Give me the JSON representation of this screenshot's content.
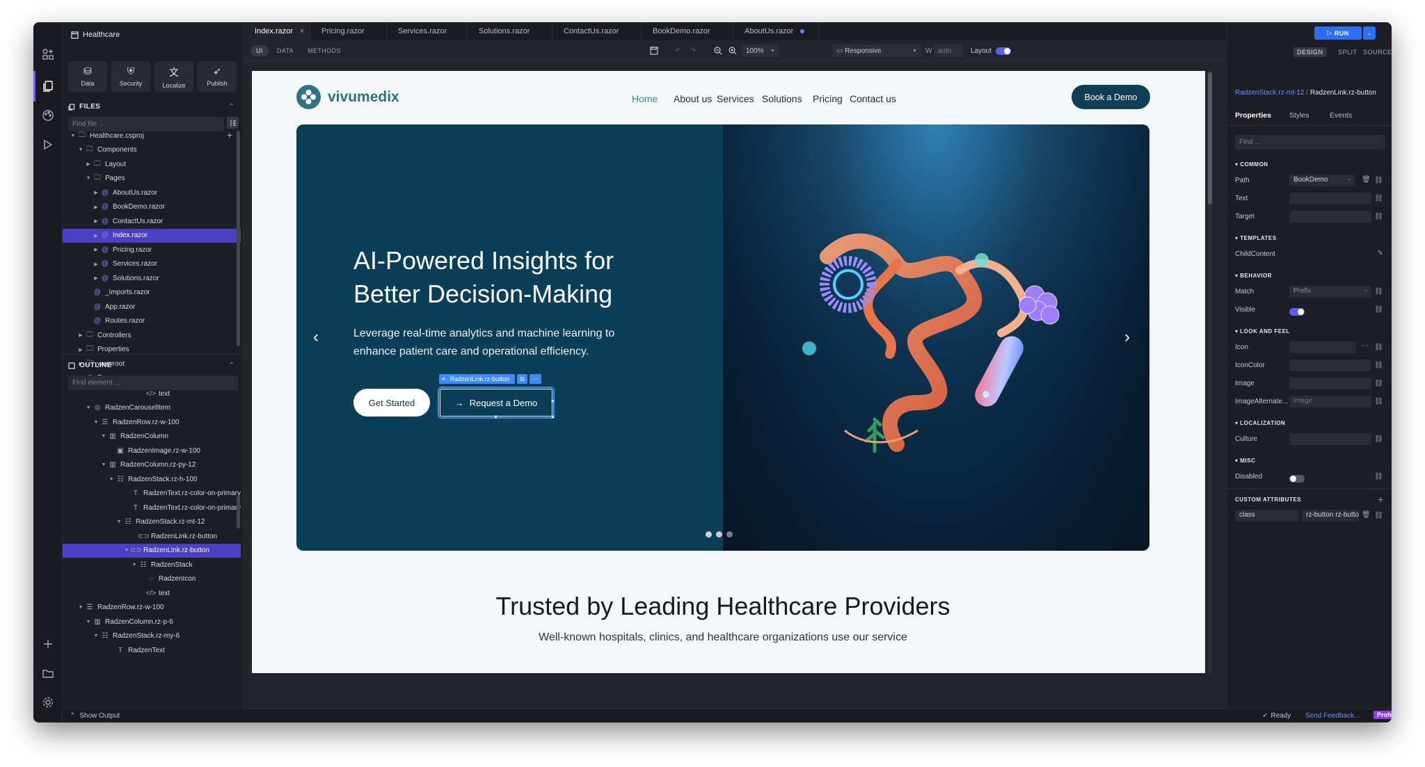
{
  "project": {
    "name": "Healthcare"
  },
  "toolbox": [
    {
      "label": "Data",
      "icon": "database-icon"
    },
    {
      "label": "Security",
      "icon": "shield-icon"
    },
    {
      "label": "Localize",
      "icon": "translate-icon"
    },
    {
      "label": "Publish",
      "icon": "rocket-icon"
    }
  ],
  "files": {
    "title": "FILES",
    "search_placeholder": "Find file ...",
    "tree": [
      {
        "label": "Healthcare.csproj",
        "kind": "folder",
        "depth": 0,
        "arrow": "down"
      },
      {
        "label": "Components",
        "kind": "folder",
        "depth": 1,
        "arrow": "down"
      },
      {
        "label": "Layout",
        "kind": "folder",
        "depth": 2,
        "arrow": "right"
      },
      {
        "label": "Pages",
        "kind": "folder",
        "depth": 2,
        "arrow": "down"
      },
      {
        "label": "AboutUs.razor",
        "kind": "razor",
        "depth": 3,
        "arrow": "right"
      },
      {
        "label": "BookDemo.razor",
        "kind": "razor",
        "depth": 3,
        "arrow": "right"
      },
      {
        "label": "ContactUs.razor",
        "kind": "razor",
        "depth": 3,
        "arrow": "right"
      },
      {
        "label": "Index.razor",
        "kind": "razor",
        "depth": 3,
        "arrow": "right",
        "selected": true
      },
      {
        "label": "Pricing.razor",
        "kind": "razor",
        "depth": 3,
        "arrow": "right"
      },
      {
        "label": "Services.razor",
        "kind": "razor",
        "depth": 3,
        "arrow": "right"
      },
      {
        "label": "Solutions.razor",
        "kind": "razor",
        "depth": 3,
        "arrow": "right"
      },
      {
        "label": "_Imports.razor",
        "kind": "razor",
        "depth": 2,
        "arrow": ""
      },
      {
        "label": "App.razor",
        "kind": "razor",
        "depth": 2,
        "arrow": ""
      },
      {
        "label": "Routes.razor",
        "kind": "razor",
        "depth": 2,
        "arrow": ""
      },
      {
        "label": "Controllers",
        "kind": "folder",
        "depth": 1,
        "arrow": "right"
      },
      {
        "label": "Properties",
        "kind": "folder",
        "depth": 1,
        "arrow": "right"
      },
      {
        "label": "wwwroot",
        "kind": "folder",
        "depth": 1,
        "arrow": "right"
      },
      {
        "label": "Program.cs",
        "kind": "cs",
        "depth": 1,
        "arrow": ""
      }
    ]
  },
  "outline": {
    "title": "OUTLINE",
    "search_placeholder": "Find element ...",
    "tree": [
      {
        "label": "text",
        "kind": "code",
        "depth": 9,
        "arrow": ""
      },
      {
        "label": "RadzenCarouselItem",
        "kind": "carousel",
        "depth": 2,
        "arrow": "down"
      },
      {
        "label": "RadzenRow.rz-w-100",
        "kind": "row",
        "depth": 3,
        "arrow": "down"
      },
      {
        "label": "RadzenColumn",
        "kind": "col",
        "depth": 4,
        "arrow": "down"
      },
      {
        "label": "RadzenImage.rz-w-100",
        "kind": "image",
        "depth": 5,
        "arrow": ""
      },
      {
        "label": "RadzenColumn.rz-py-12",
        "kind": "col",
        "depth": 4,
        "arrow": "down"
      },
      {
        "label": "RadzenStack.rz-h-100",
        "kind": "stack",
        "depth": 5,
        "arrow": "down"
      },
      {
        "label": "RadzenText.rz-color-on-primary",
        "kind": "text",
        "depth": 7,
        "arrow": ""
      },
      {
        "label": "RadzenText.rz-color-on-primary",
        "kind": "text",
        "depth": 7,
        "arrow": ""
      },
      {
        "label": "RadzenStack.rz-mt-12",
        "kind": "stack",
        "depth": 6,
        "arrow": "down"
      },
      {
        "label": "RadzenLink.rz-button",
        "kind": "link",
        "depth": 8,
        "arrow": ""
      },
      {
        "label": "RadzenLink.rz-button",
        "kind": "link",
        "depth": 7,
        "arrow": "down",
        "selected": true
      },
      {
        "label": "RadzenStack",
        "kind": "stack",
        "depth": 8,
        "arrow": "down"
      },
      {
        "label": "RadzenIcon",
        "kind": "icon",
        "depth": 9,
        "arrow": ""
      },
      {
        "label": "text",
        "kind": "code",
        "depth": 9,
        "arrow": ""
      },
      {
        "label": "RadzenRow.rz-w-100",
        "kind": "row",
        "depth": 1,
        "arrow": "down"
      },
      {
        "label": "RadzenColumn.rz-p-6",
        "kind": "col",
        "depth": 2,
        "arrow": "down"
      },
      {
        "label": "RadzenStack.rz-my-6",
        "kind": "stack",
        "depth": 3,
        "arrow": "down"
      },
      {
        "label": "RadzenText",
        "kind": "text",
        "depth": 5,
        "arrow": ""
      }
    ]
  },
  "tabs": [
    {
      "label": "Index.razor",
      "active": true,
      "closable": true
    },
    {
      "label": "Pricing.razor"
    },
    {
      "label": "Services.razor"
    },
    {
      "label": "Solutions.razor"
    },
    {
      "label": "ContactUs.razor"
    },
    {
      "label": "BookDemo.razor"
    },
    {
      "label": "AboutUs.razor",
      "modified": true
    }
  ],
  "viewmodes": [
    "UI",
    "DATA",
    "METHODS"
  ],
  "toolbar": {
    "zoom": "100%",
    "device": "Responsive",
    "width_label": "W",
    "width_placeholder": "auto",
    "layout_label": "Layout"
  },
  "site": {
    "brand": "vivumedix",
    "nav": [
      "Home",
      "About us",
      "Services",
      "Solutions",
      "Pricing",
      "Contact us"
    ],
    "cta": "Book a Demo",
    "hero_title_1": "AI-Powered Insights for",
    "hero_title_2": "Better Decision-Making",
    "hero_sub_1": "Leverage real-time analytics and machine learning to",
    "hero_sub_2": "enhance patient care and operational efficiency.",
    "btn_primary": "Get Started",
    "btn_secondary": "Request a Demo",
    "selection_tag": "RadzenLink.rz-button",
    "trust_title": "Trusted by Leading Healthcare Providers",
    "trust_sub": "Well-known hospitals, clinics, and healthcare organizations use our service",
    "carousel_pages": 3,
    "carousel_active": 1
  },
  "right": {
    "run": "RUN",
    "modes": [
      "DESIGN",
      "SPLIT",
      "SOURCE"
    ],
    "breadcrumb_parent": "RadzenStack.rz-mt-12",
    "breadcrumb_current": "RadzenLink.rz-button",
    "ptabs": [
      "Properties",
      "Styles",
      "Events"
    ],
    "find_placeholder": "Find ...",
    "sections": {
      "common": "COMMON",
      "templates": "TEMPLATES",
      "behavior": "BEHAVIOR",
      "look": "LOOK AND FEEL",
      "localization": "LOCALIZATION",
      "misc": "MISC",
      "custom": "CUSTOM ATTRIBUTES"
    },
    "props": {
      "path_label": "Path",
      "path_value": "BookDemo",
      "text_label": "Text",
      "target_label": "Target",
      "child_label": "ChildContent",
      "match_label": "Match",
      "match_value": "Prefix",
      "visible_label": "Visible",
      "icon_label": "Icon",
      "iconcolor_label": "IconColor",
      "image_label": "Image",
      "imagealt_label": "ImageAlternate...",
      "imagealt_placeholder": "image",
      "culture_label": "Culture",
      "disabled_label": "Disabled",
      "attr_name": "class",
      "attr_value": "rz-button rz-butto"
    }
  },
  "status": {
    "show_output": "Show Output",
    "ready": "Ready",
    "feedback": "Send Feedback...",
    "edition": "Professional"
  }
}
